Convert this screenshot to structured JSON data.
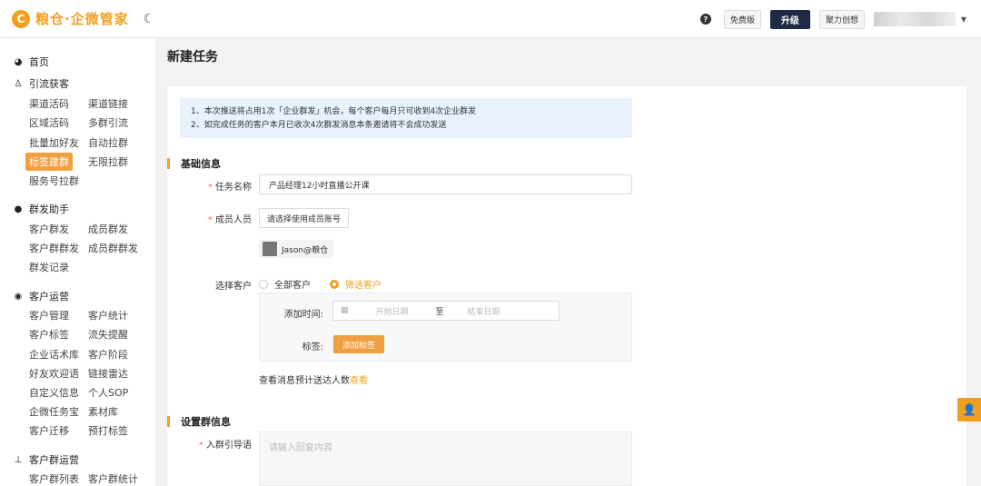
{
  "header": {
    "logo_mark": "C",
    "logo_text": "粮仓·企微管家",
    "moon_icon": "☾",
    "help": "?",
    "free_label": "免费版",
    "upgrade_label": "升级",
    "partner_label": "聚力创想"
  },
  "sidebar": {
    "home": "首页",
    "groups": [
      {
        "title": "引流获客",
        "items": [
          "渠道活码",
          "渠道链接",
          "区域活码",
          "多群引流",
          "批量加好友",
          "自动拉群",
          "标签建群",
          "无限拉群",
          "服务号拉群"
        ]
      },
      {
        "title": "群发助手",
        "items": [
          "客户群发",
          "成员群发",
          "客户群群发",
          "成员群群发",
          "群发记录"
        ]
      },
      {
        "title": "客户运营",
        "items": [
          "客户管理",
          "客户统计",
          "客户标签",
          "流失提醒",
          "企业话术库",
          "客户阶段",
          "好友欢迎语",
          "链接雷达",
          "自定义信息",
          "个人SOP",
          "企微任务宝",
          "素材库",
          "客户迁移",
          "预打标签"
        ]
      },
      {
        "title": "客户群运营",
        "items": [
          "客户群列表",
          "客户群统计"
        ]
      }
    ]
  },
  "page": {
    "title": "新建任务",
    "notice": [
      "1、本次推送将占用1次「企业群发」机会，每个客户每月只可收到4次企业群发",
      "2、如完成任务的客户本月已收次4次群发消息本条邀请将不会成功发送"
    ],
    "basic_section": "基础信息",
    "task_name_label": "任务名称",
    "task_name_value": "产品经理12小时直播公开课",
    "member_label": "成员人员",
    "member_button": "请选择使用成员账号",
    "member_chip": "Jason@粮仓",
    "select_customer_label": "选择客户",
    "option_all": "全部客户",
    "option_filter": "筛选客户",
    "add_time_label": "添加时间:",
    "start_placeholder": "开始日期",
    "range_sep": "至",
    "end_placeholder": "结束日期",
    "tag_label": "标签:",
    "add_tag_button": "添加标签",
    "preview_text": "查看消息预计送达人数",
    "preview_link": "查看",
    "group_section": "设置群信息",
    "guide_label": "入群引导语",
    "guide_placeholder": "请输入回复内容"
  },
  "colors": {
    "accent": "#f0a020",
    "dark": "#1f2a44",
    "notice_bg": "#e8f1fc"
  }
}
